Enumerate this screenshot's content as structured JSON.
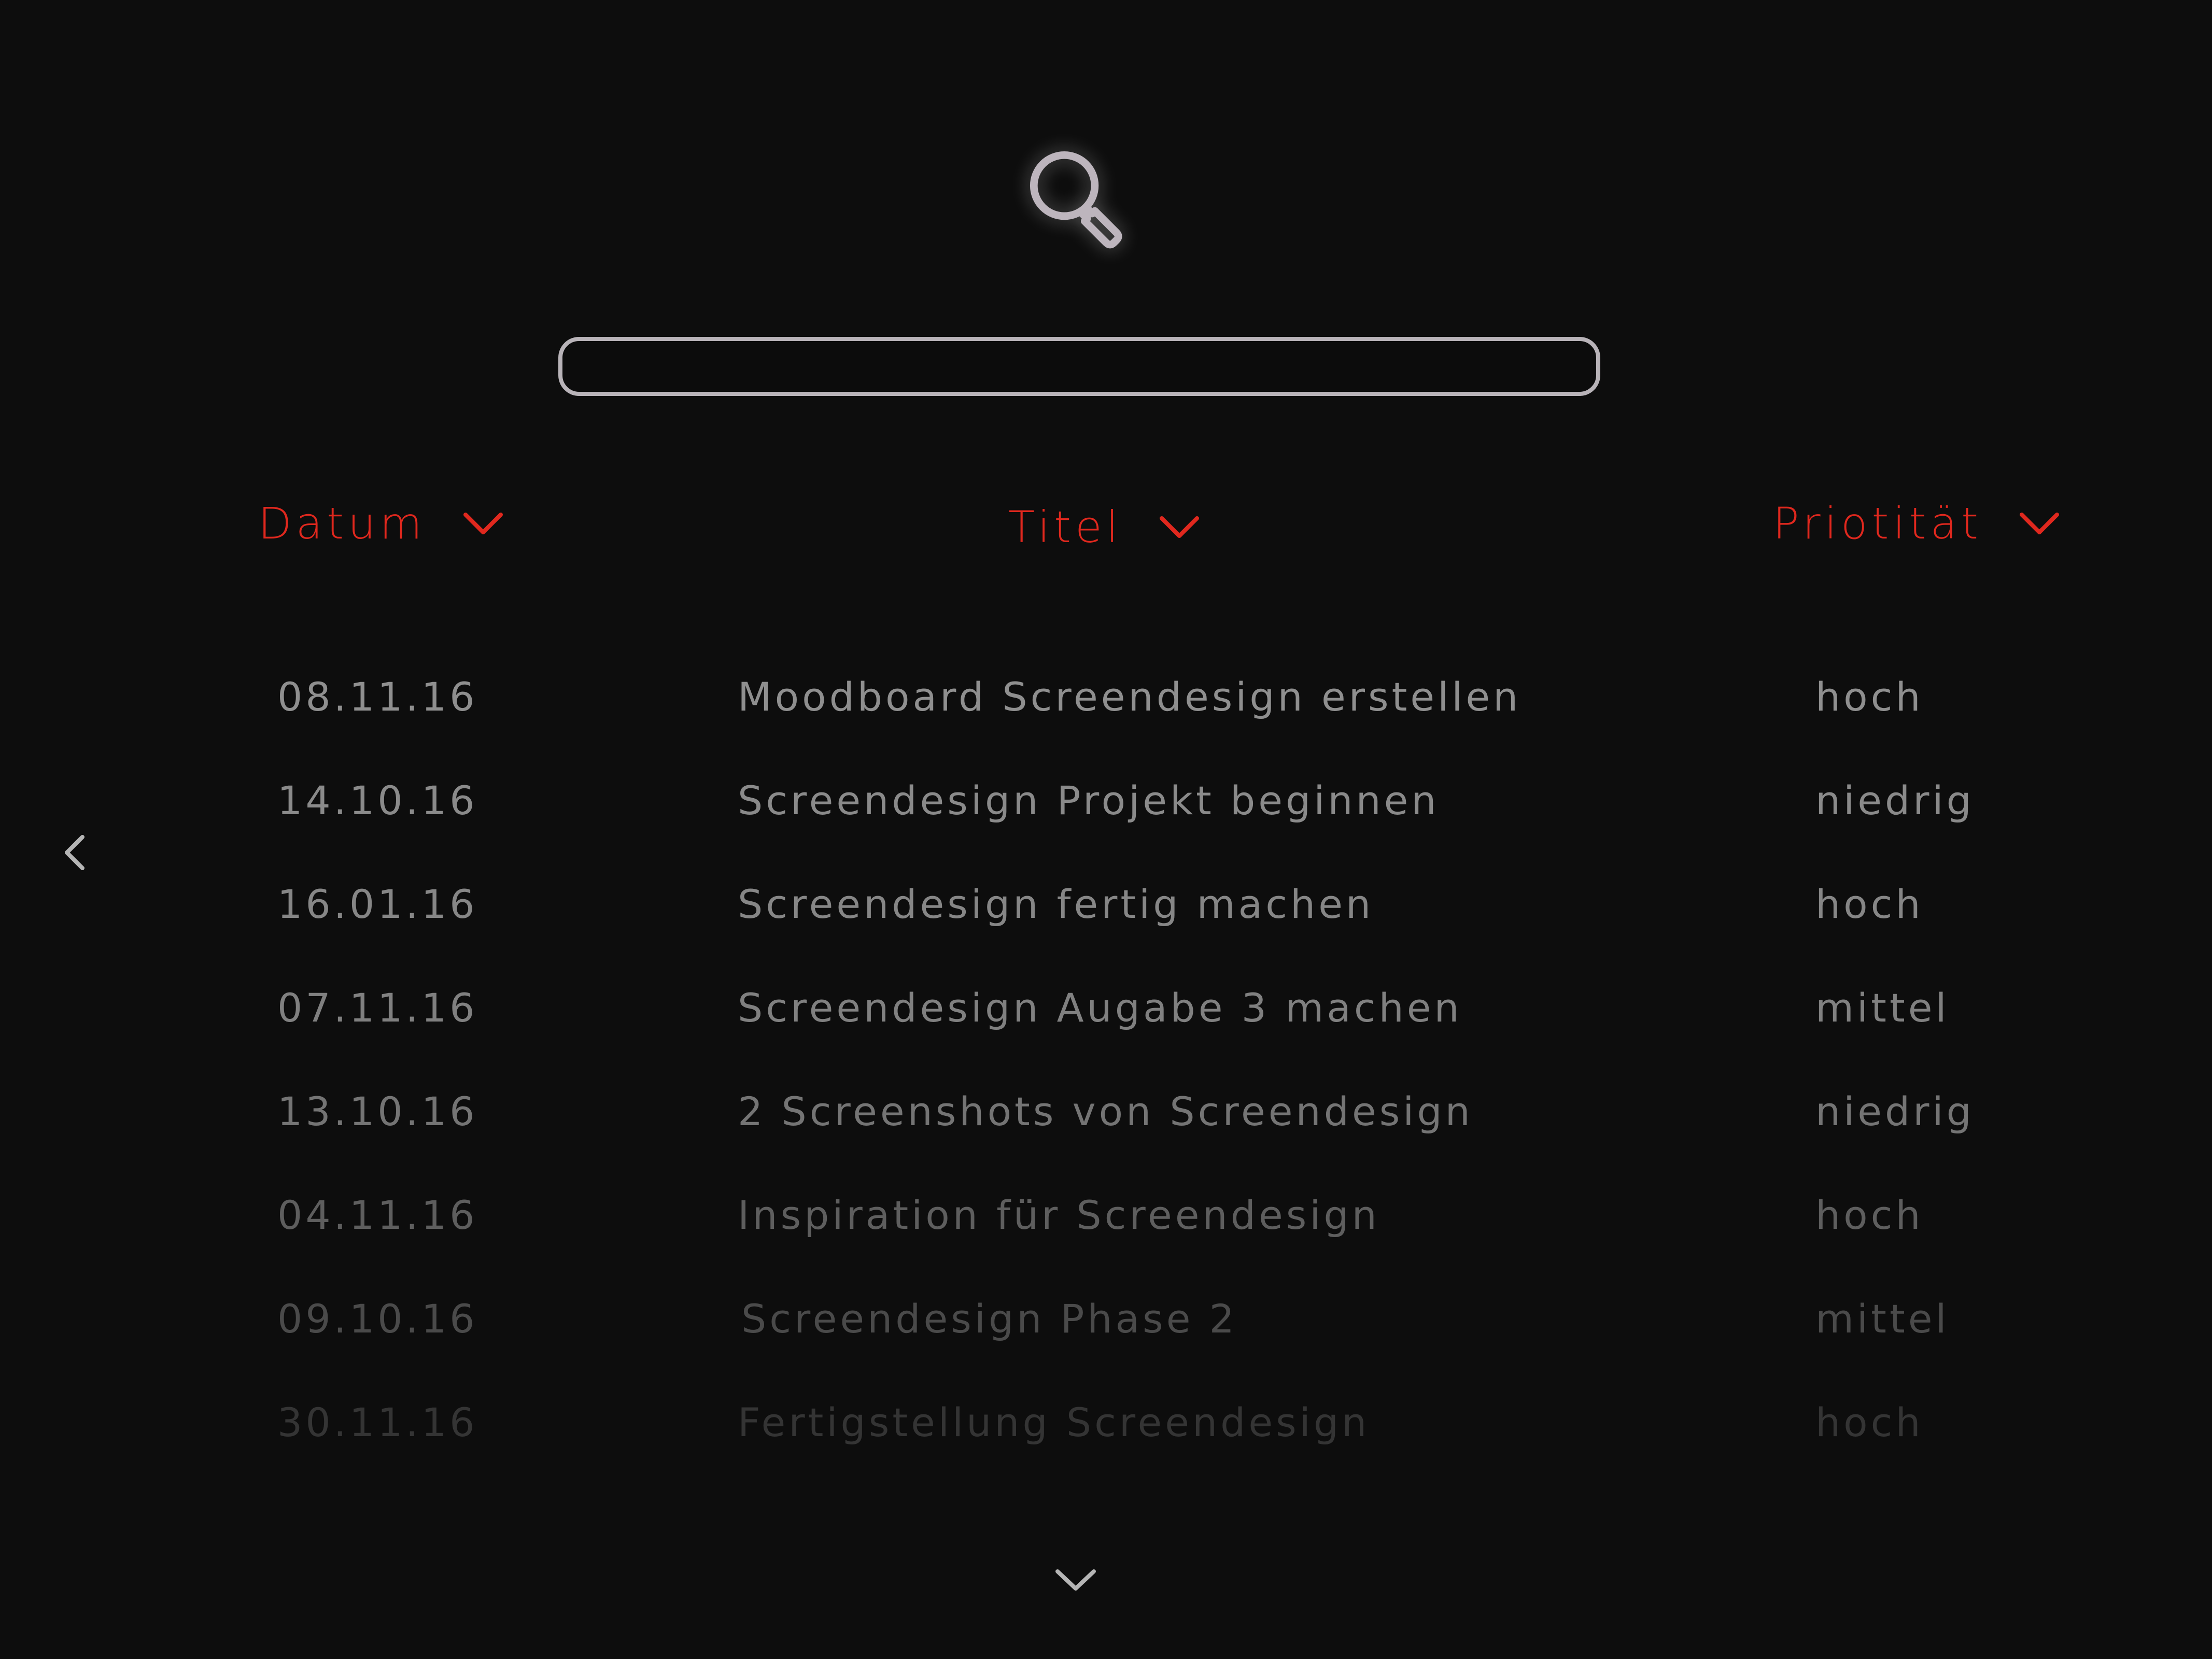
{
  "icons": {
    "search": "search-icon",
    "sort": "chevron-down-icon",
    "back": "chevron-left-icon",
    "more": "chevron-down-icon"
  },
  "colors": {
    "background": "#0d0d0d",
    "accent": "#e0281e",
    "search_border": "#b8b3b8",
    "text": "#8c8c8c"
  },
  "search": {
    "value": "",
    "placeholder": ""
  },
  "table": {
    "headers": {
      "date": "Datum",
      "title": "Titel",
      "priority": "Priotität"
    },
    "rows": [
      {
        "date": "08.11.16",
        "title": "Moodboard Screendesign erstellen",
        "priority": "hoch"
      },
      {
        "date": "14.10.16",
        "title": "Screendesign Projekt beginnen",
        "priority": "niedrig"
      },
      {
        "date": "16.01.16",
        "title": "Screendesign fertig machen",
        "priority": "hoch"
      },
      {
        "date": "07.11.16",
        "title": "Screendesign Augabe 3 machen",
        "priority": "mittel"
      },
      {
        "date": "13.10.16",
        "title": "2 Screenshots von Screendesign",
        "priority": "niedrig"
      },
      {
        "date": "04.11.16",
        "title": "Inspiration für Screendesign",
        "priority": "hoch"
      },
      {
        "date": "09.10.16",
        "title": "Screendesign Phase 2",
        "priority": "mittel"
      },
      {
        "date": "30.11.16",
        "title": "Fertigstellung Screendesign",
        "priority": "hoch"
      }
    ]
  }
}
